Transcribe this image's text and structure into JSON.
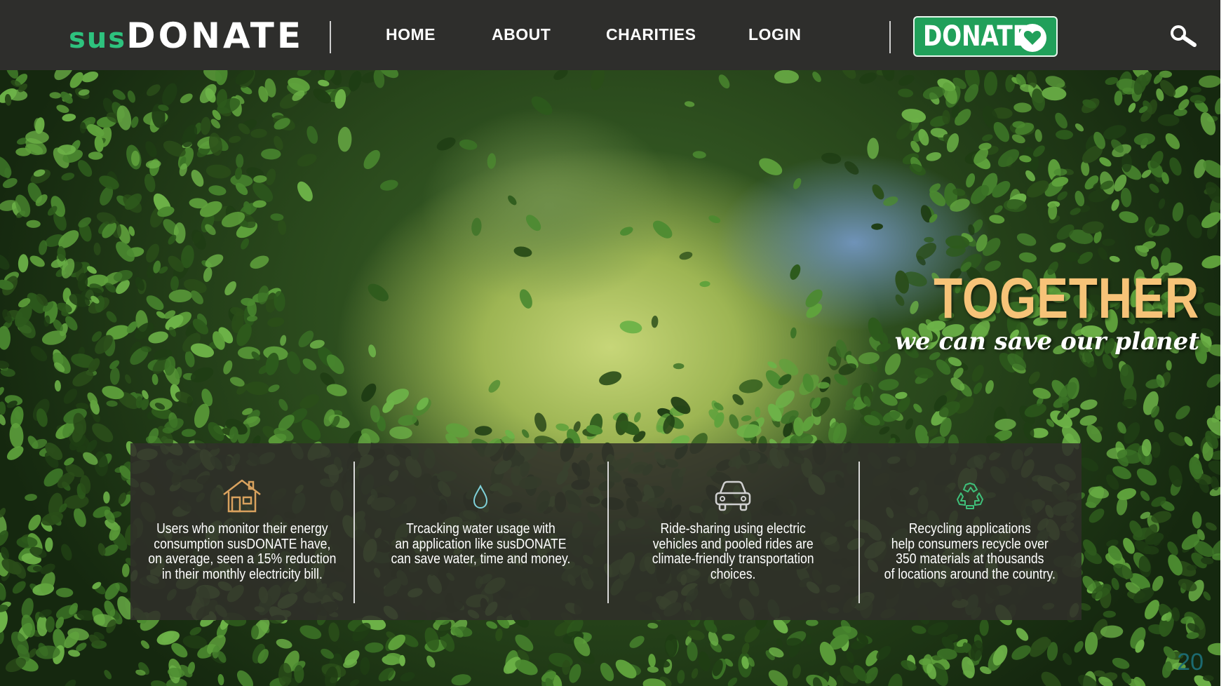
{
  "brand": {
    "prefix": "sus",
    "name": "DONATE"
  },
  "nav": {
    "items": [
      {
        "label": "HOME"
      },
      {
        "label": "ABOUT"
      },
      {
        "label": "CHARITIES"
      },
      {
        "label": "LOGIN"
      }
    ],
    "donate_label": "DONATE"
  },
  "icons": {
    "search": "search-icon",
    "donate_heart": "heart-icon",
    "features": [
      "house-icon",
      "water-drop-icon",
      "car-icon",
      "recycle-icon"
    ]
  },
  "hero": {
    "title": "TOGETHER",
    "subtitle": "we can save our planet"
  },
  "features": [
    {
      "text": "Users who monitor their energy\nconsumption susDONATE have,\non average, seen a 15% reduction\nin their monthly electricity bill."
    },
    {
      "text": "Trcacking water usage with\nan application like susDONATE\ncan save water, time and money."
    },
    {
      "text": "Ride-sharing using electric\nvehicles and pooled rides are\nclimate-friendly transportation\nchoices."
    },
    {
      "text": "Recycling applications\nhelp consumers recycle over\n350 materials at thousands\nof locations around the country."
    }
  ],
  "page_number": "20",
  "colors": {
    "nav_bg": "#2e2e2c",
    "brand_green": "#2ec27e",
    "donate_green": "#21a05a",
    "title_gold": "#f6c378",
    "icon_gold": "#d9a25e",
    "icon_teal": "#7fd1d9",
    "icon_gray": "#d0d0d0",
    "icon_green": "#3fbf7a"
  }
}
